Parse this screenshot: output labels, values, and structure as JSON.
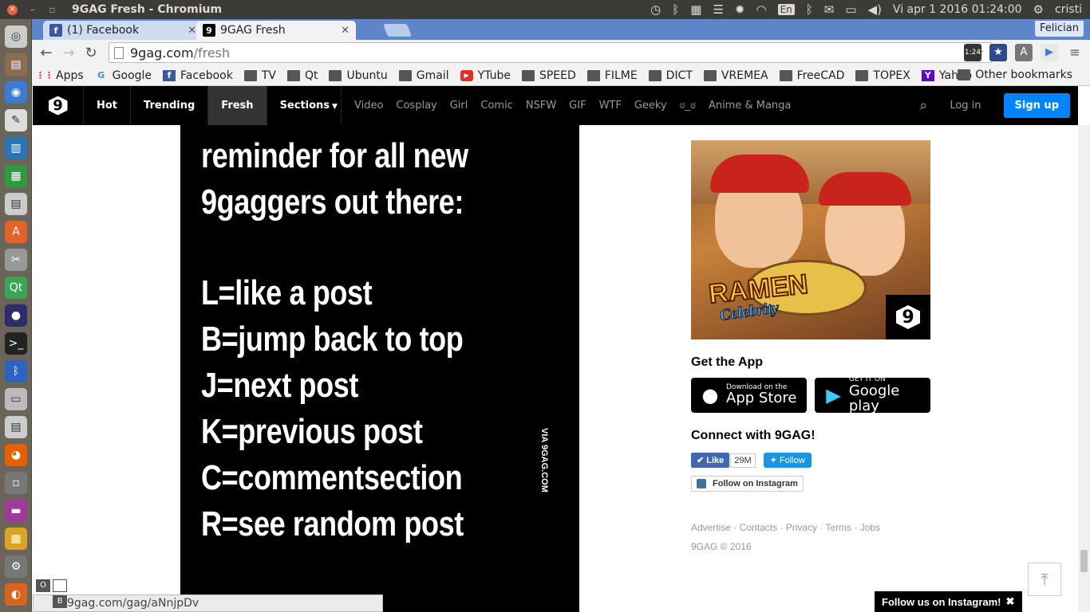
{
  "os": {
    "window_title": "9GAG Fresh - Chromium",
    "lang": "En",
    "clock": "Vi apr  1 2016 01:24:00",
    "user": "cristi"
  },
  "browser": {
    "tabs": [
      {
        "label": "(1) Facebook",
        "favicon": "facebook-icon",
        "active": false
      },
      {
        "label": "9GAG Fresh",
        "favicon": "9gag-icon",
        "active": true
      }
    ],
    "profile": "Felician",
    "url_host": "9gag.com",
    "url_path": "/fresh",
    "extension_badge": "1:24",
    "bookmarks": [
      {
        "label": "Apps",
        "icon": "apps-icon"
      },
      {
        "label": "Google",
        "icon": "google-icon"
      },
      {
        "label": "Facebook",
        "icon": "facebook-icon"
      },
      {
        "label": "TV",
        "icon": "folder-icon"
      },
      {
        "label": "Qt",
        "icon": "folder-icon"
      },
      {
        "label": "Ubuntu",
        "icon": "folder-icon"
      },
      {
        "label": "Gmail",
        "icon": "folder-icon"
      },
      {
        "label": "YTube",
        "icon": "youtube-icon"
      },
      {
        "label": "SPEED",
        "icon": "folder-icon"
      },
      {
        "label": "FILME",
        "icon": "folder-icon"
      },
      {
        "label": "DICT",
        "icon": "folder-icon"
      },
      {
        "label": "VREMEA",
        "icon": "folder-icon"
      },
      {
        "label": "FreeCAD",
        "icon": "folder-icon"
      },
      {
        "label": "TOPEX",
        "icon": "folder-icon"
      },
      {
        "label": "Yahoo",
        "icon": "yahoo-icon"
      }
    ],
    "other_bookmarks": "Other bookmarks",
    "status_url": "9gag.com/gag/aNnjpDv",
    "vim_o": "O",
    "vim_b": "B"
  },
  "gag": {
    "main_nav": [
      "Hot",
      "Trending",
      "Fresh",
      "Sections"
    ],
    "active_nav": "Fresh",
    "sections": [
      "Video",
      "Cosplay",
      "Girl",
      "Comic",
      "NSFW",
      "GIF",
      "WTF",
      "Geeky",
      "ಠ_ಠ",
      "Anime & Manga"
    ],
    "login": "Log in",
    "signup": "Sign up",
    "post_lines": [
      "reminder for all new",
      "9gaggers out there:",
      "L=like a post",
      "B=jump back to top",
      "J=next post",
      "K=previous post",
      "C=commentsection",
      "R=see random post"
    ],
    "watermark": "VIA 9GAG.COM",
    "ad": {
      "title": "RAMEN",
      "subtitle": "Celebrity"
    },
    "get_app": "Get the App",
    "app_store": {
      "small": "Download on the",
      "big": "App Store"
    },
    "google_play": {
      "small": "GET IT ON",
      "big": "Google play"
    },
    "connect": "Connect with 9GAG!",
    "fb_like": "Like",
    "fb_count": "29M",
    "tw_follow": "Follow",
    "ig_follow": "Follow on Instagram",
    "footer_links": "Advertise · Contacts · Privacy · Terms · Jobs",
    "copyright": "9GAG © 2016",
    "ig_toast": "Follow us on Instagram!",
    "ig_toast_close": "✖"
  },
  "colors": {
    "signup_blue": "#0085ff",
    "tabstrip": "#5e85c9",
    "nav_bg": "#000000"
  }
}
